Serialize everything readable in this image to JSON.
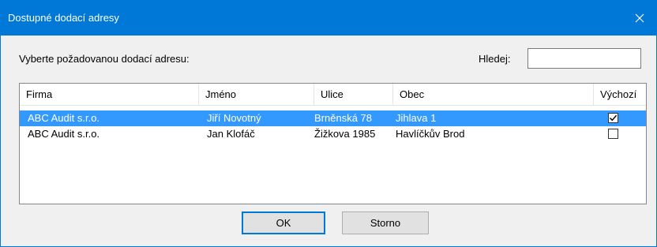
{
  "dialog": {
    "title": "Dostupné dodací adresy",
    "prompt": "Vyberte požadovanou dodací adresu:",
    "search_label": "Hledej:",
    "search_value": ""
  },
  "table": {
    "columns": [
      "Firma",
      "Jméno",
      "Ulice",
      "Obec",
      "Výchozí"
    ],
    "rows": [
      {
        "firma": "ABC Audit s.r.o.",
        "jmeno": "Jiří Novotný",
        "ulice": "Brněnská 78",
        "obec": "Jihlava 1",
        "vychozi": true,
        "selected": true
      },
      {
        "firma": "ABC Audit s.r.o.",
        "jmeno": "Jan Klofáč",
        "ulice": "Žižkova 1985",
        "obec": "Havlíčkův Brod",
        "vychozi": false,
        "selected": false
      }
    ]
  },
  "buttons": {
    "ok": "OK",
    "cancel": "Storno"
  },
  "colors": {
    "titlebar": "#0078d7",
    "selection": "#3399ff"
  },
  "icons": {
    "close": "close-icon",
    "checkmark": "checkmark-icon"
  }
}
